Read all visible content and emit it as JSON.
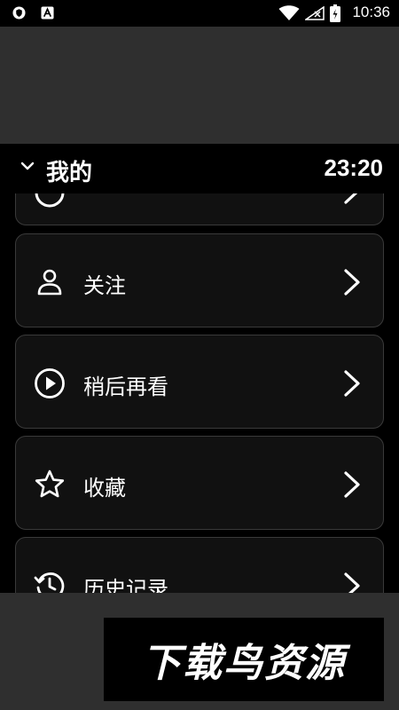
{
  "status_bar": {
    "time": "10:36",
    "icons": [
      "shield-icon",
      "a-icon",
      "wifi-icon",
      "no-signal-icon",
      "battery-icon"
    ]
  },
  "header": {
    "title": "我的",
    "clock": "23:20",
    "collapse_icon": "chevron-down-icon"
  },
  "menu": {
    "items": [
      {
        "label": "关注",
        "icon": "person-icon"
      },
      {
        "label": "稍后再看",
        "icon": "play-circle-icon"
      },
      {
        "label": "收藏",
        "icon": "star-icon"
      },
      {
        "label": "历史记录",
        "icon": "history-icon"
      }
    ]
  },
  "watermark": {
    "text": "下载鸟资源"
  }
}
